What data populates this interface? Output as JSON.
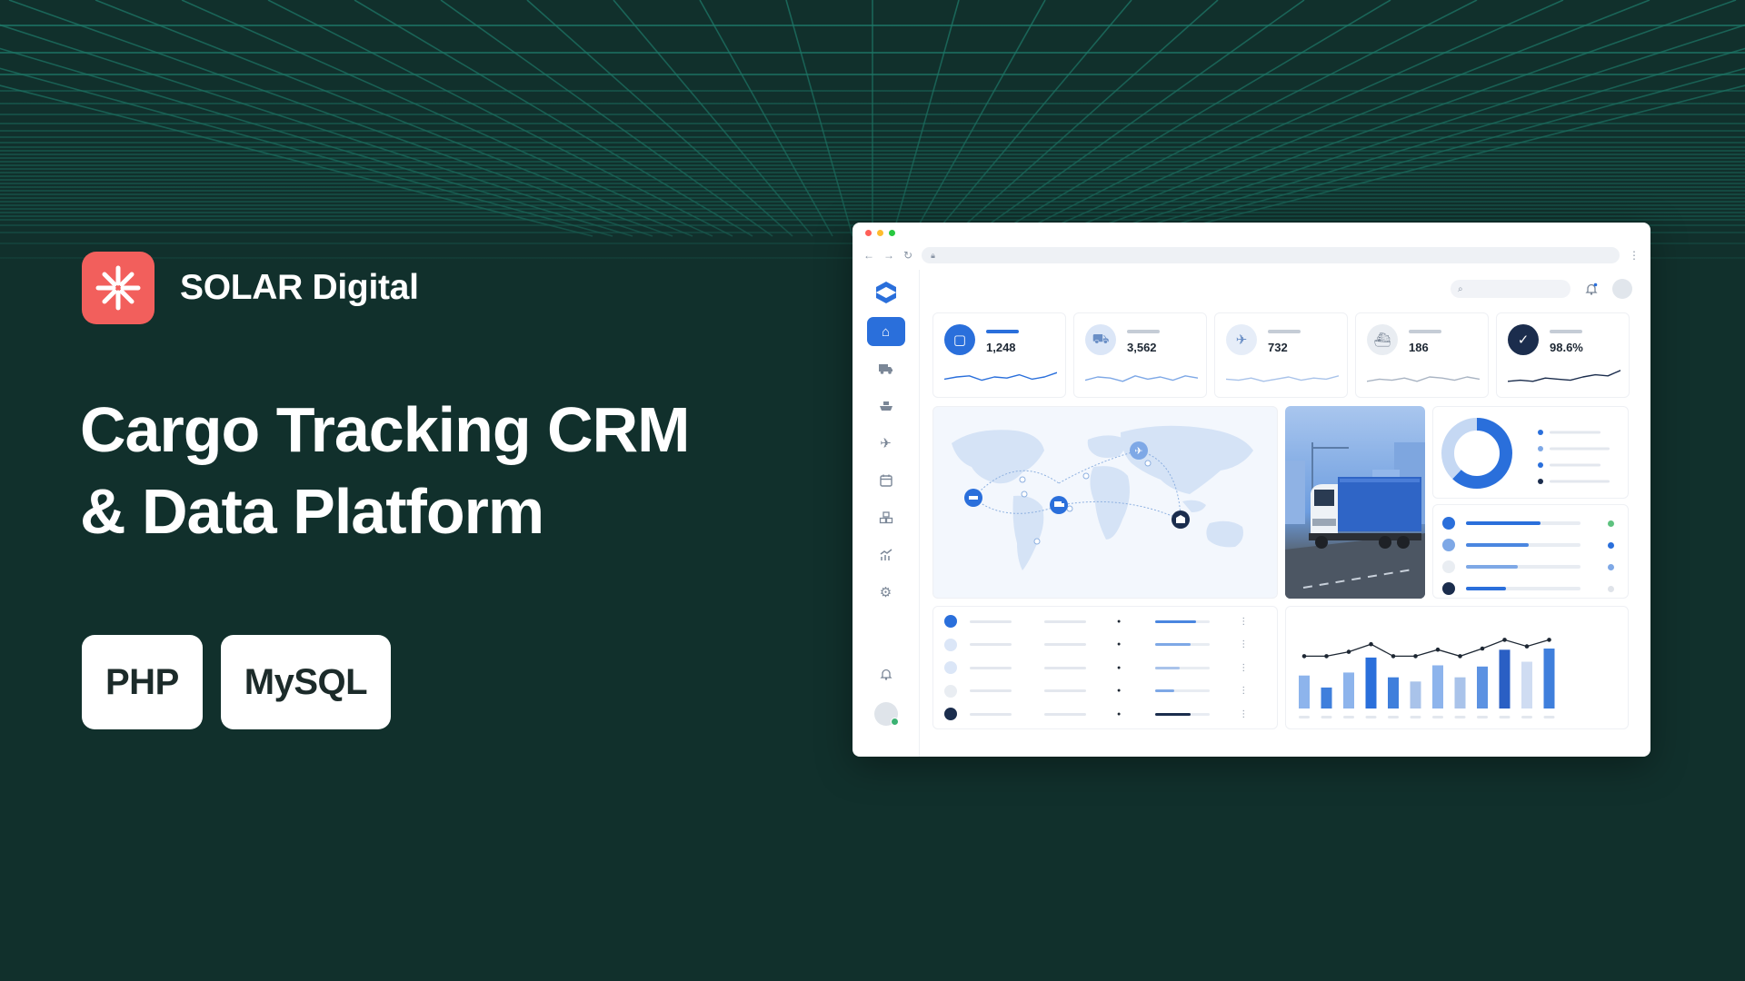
{
  "brand": {
    "name": "SOLAR Digital",
    "logo_icon": "asterisk-logo",
    "logo_color": "#f25f5c"
  },
  "headline": {
    "line1": "Cargo Tracking CRM",
    "line2": "& Data Platform"
  },
  "tags": [
    "PHP",
    "MySQL"
  ],
  "colors": {
    "background": "#11302c",
    "accent": "#2a6fdb",
    "grid": "#1f7d6c"
  },
  "dashboard": {
    "stats": [
      {
        "icon": "box-icon",
        "value": "1,248",
        "trend": [
          0.4,
          0.5,
          0.55,
          0.35,
          0.5,
          0.45,
          0.6,
          0.4,
          0.5,
          0.7
        ]
      },
      {
        "icon": "truck-icon",
        "value": "3,562",
        "trend": [
          0.35,
          0.5,
          0.45,
          0.3,
          0.55,
          0.4,
          0.5,
          0.35,
          0.55,
          0.45
        ]
      },
      {
        "icon": "plane-icon",
        "value": "732",
        "trend": [
          0.4,
          0.35,
          0.45,
          0.3,
          0.4,
          0.5,
          0.35,
          0.45,
          0.4,
          0.55
        ]
      },
      {
        "icon": "ship-icon",
        "value": "186",
        "trend": [
          0.3,
          0.4,
          0.35,
          0.45,
          0.3,
          0.5,
          0.45,
          0.35,
          0.5,
          0.4
        ]
      },
      {
        "icon": "check-icon",
        "value": "98.6%",
        "trend": [
          0.3,
          0.35,
          0.3,
          0.45,
          0.4,
          0.35,
          0.5,
          0.6,
          0.55,
          0.8
        ]
      }
    ],
    "donut": {
      "segments": [
        0.62,
        0.38
      ]
    },
    "progress": [
      0.65,
      0.55,
      0.45,
      0.35
    ],
    "table_progress": [
      0.75,
      0.65,
      0.45,
      0.35,
      0.65
    ],
    "bars": [
      0.55,
      0.35,
      0.6,
      0.85,
      0.52,
      0.45,
      0.72,
      0.52,
      0.7,
      0.98,
      0.78,
      1.0
    ],
    "line": [
      0.66,
      0.66,
      0.74,
      0.88,
      0.66,
      0.66,
      0.78,
      0.66,
      0.8,
      0.96,
      0.84,
      0.96
    ]
  }
}
